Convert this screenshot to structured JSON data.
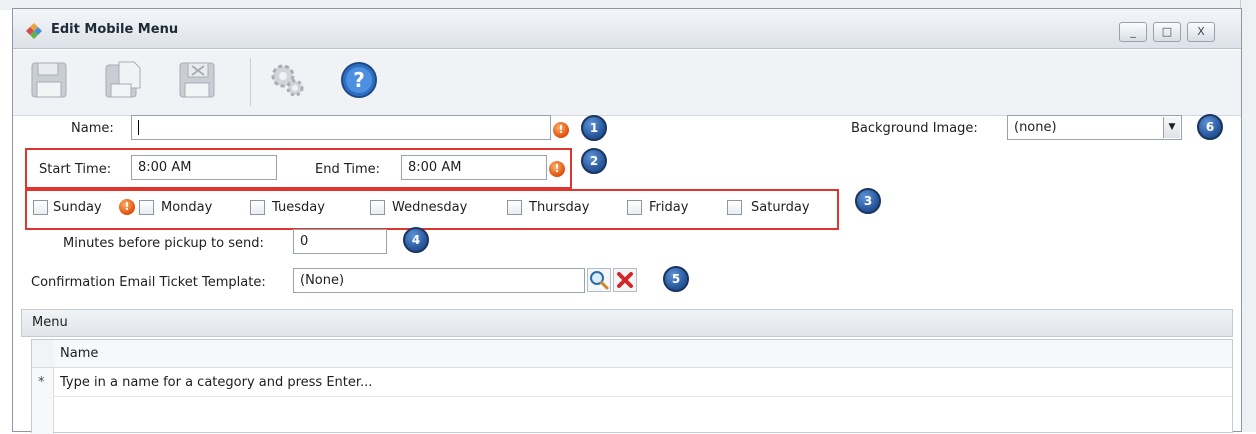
{
  "window": {
    "title": "Edit Mobile Menu",
    "controls": {
      "minimize": "_",
      "maximize": "□",
      "close": "X"
    }
  },
  "toolbar": {
    "buttons": [
      {
        "name": "save",
        "icon": "floppy-disk-icon"
      },
      {
        "name": "save-new",
        "icon": "floppy-new-icon"
      },
      {
        "name": "save-close",
        "icon": "floppy-close-icon"
      },
      {
        "name": "options",
        "icon": "gears-icon"
      },
      {
        "name": "help",
        "icon": "help-icon"
      }
    ]
  },
  "form": {
    "name_label": "Name:",
    "name_value": "",
    "start_time_label": "Start Time:",
    "start_time_value": "8:00 AM",
    "end_time_label": "End Time:",
    "end_time_value": "8:00 AM",
    "days": [
      "Sunday",
      "Monday",
      "Tuesday",
      "Wednesday",
      "Thursday",
      "Friday",
      "Saturday"
    ],
    "minutes_label": "Minutes before pickup to send:",
    "minutes_value": "0",
    "confirmation_label": "Confirmation Email Ticket Template:",
    "confirmation_value": "(None)",
    "background_label": "Background Image:",
    "background_value": "(none)"
  },
  "markers": [
    "1",
    "2",
    "3",
    "4",
    "5",
    "6"
  ],
  "warning_glyph": "!",
  "menu": {
    "group_title": "Menu",
    "column_name": "Name",
    "new_row_marker": "*",
    "new_row_placeholder": "Type in a name for a category and press Enter..."
  },
  "colors": {
    "highlight_box": "#e0342d",
    "marker_blue": "#2a5aa0",
    "warning_orange": "#e2530e"
  }
}
